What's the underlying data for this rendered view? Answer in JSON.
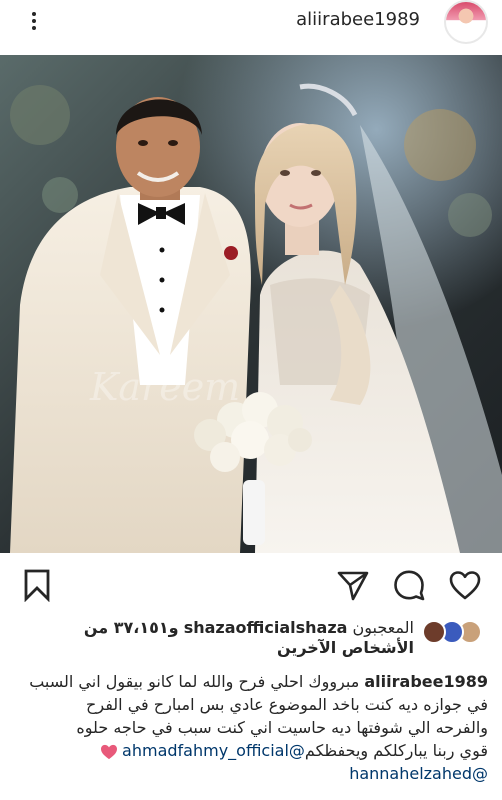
{
  "header": {
    "username": "aliirabee1989",
    "more_icon": "more-vertical-icon",
    "avatar_icon": "profile-avatar"
  },
  "photo": {
    "watermark": "Kareem"
  },
  "actions": {
    "left": [
      "bookmark-icon"
    ],
    "right": [
      "heart-icon",
      "comment-icon",
      "share-icon"
    ]
  },
  "likes": {
    "prefix": "المعجبون",
    "user": "shazaofficialshaza",
    "suffix": "و٣٧،١٥١ من الأشخاص الآخرين",
    "avatar_colors": [
      "#c9a17a",
      "#3b5bbd",
      "#6d3c2b"
    ]
  },
  "caption": {
    "username": "aliirabee1989",
    "text_line1": "مبرووك احلي فرح والله لما كانو بيقول اني السبب",
    "text_line2": "في جوازه ديه كنت باخد الموضوع عادي بس امبارح في الفرح",
    "text_line3": "والفرحه الي شوفتها ديه حاسيت اني كنت سبب في حاجه حلوه",
    "text_line4": "قوي ربنا يباركلكم ويحفظكم",
    "mention1": "@ahmadfahmy_official",
    "mention2": "@hannahelzahed",
    "heart_color": "#e8597a"
  },
  "colors": {
    "text": "#262626",
    "mention": "#00376b"
  }
}
